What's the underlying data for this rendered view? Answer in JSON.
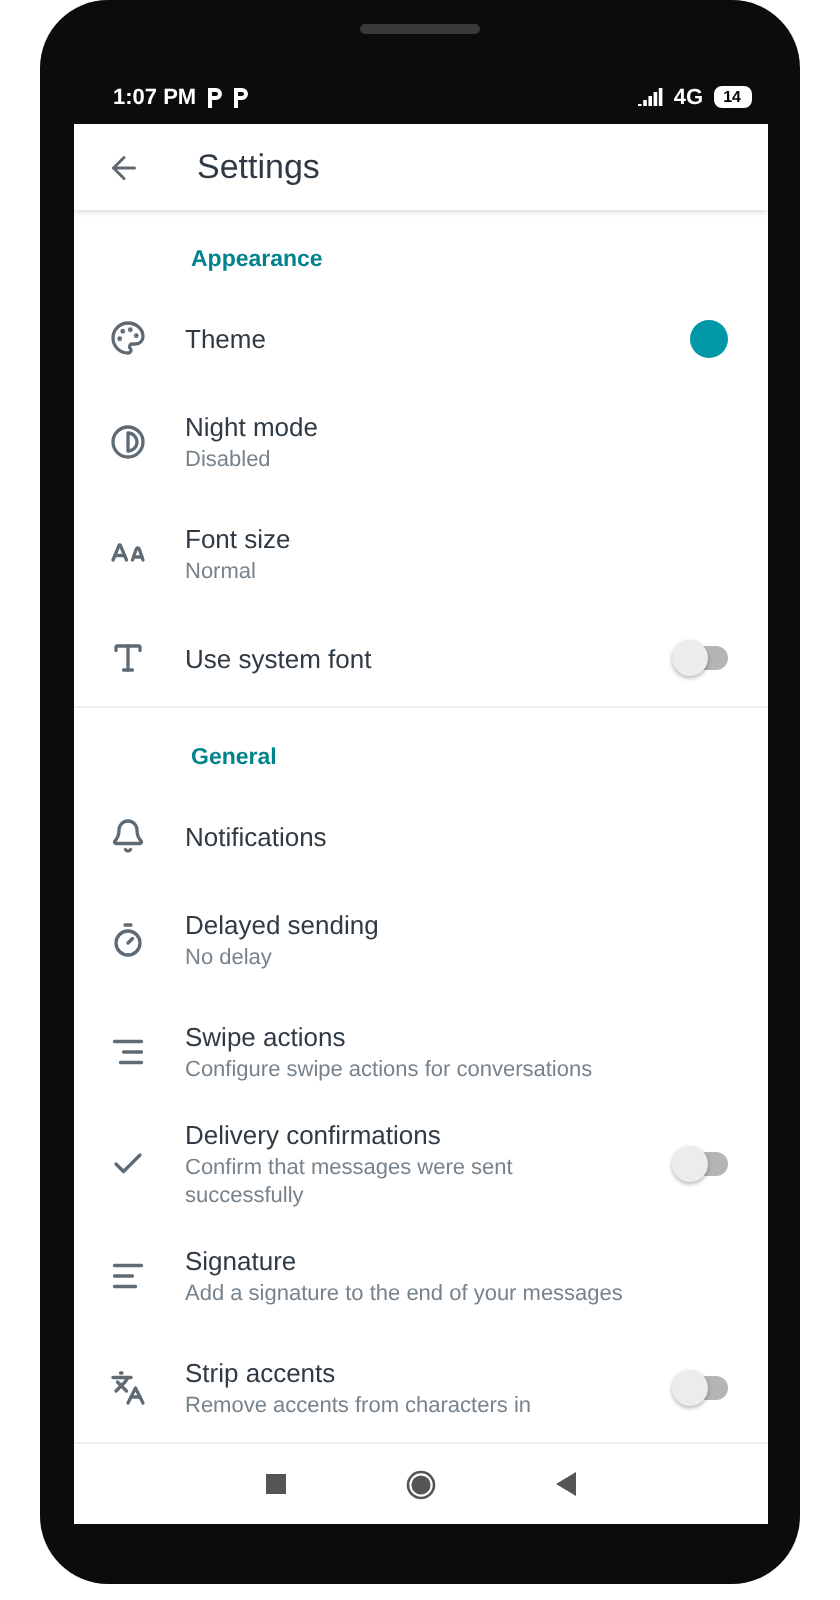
{
  "status_bar": {
    "time": "1:07 PM",
    "network": "4G",
    "battery": "14"
  },
  "toolbar": {
    "title": "Settings"
  },
  "sections": [
    {
      "title": "Appearance",
      "items": [
        {
          "kind": "color",
          "title": "Theme",
          "color": "#0097a7"
        },
        {
          "kind": "plain",
          "title": "Night mode",
          "subtitle": "Disabled"
        },
        {
          "kind": "plain",
          "title": "Font size",
          "subtitle": "Normal"
        },
        {
          "kind": "switch",
          "title": "Use system font",
          "on": false
        }
      ]
    },
    {
      "title": "General",
      "items": [
        {
          "kind": "plain",
          "title": "Notifications"
        },
        {
          "kind": "plain",
          "title": "Delayed sending",
          "subtitle": "No delay"
        },
        {
          "kind": "plain",
          "title": "Swipe actions",
          "subtitle": "Configure swipe actions for conversations"
        },
        {
          "kind": "switch",
          "title": "Delivery confirmations",
          "subtitle": "Confirm that messages were sent successfully",
          "on": false
        },
        {
          "kind": "plain",
          "title": "Signature",
          "subtitle": "Add a signature to the end of your messages"
        },
        {
          "kind": "switch",
          "title": "Strip accents",
          "subtitle": "Remove accents from characters in",
          "on": false
        }
      ]
    }
  ]
}
